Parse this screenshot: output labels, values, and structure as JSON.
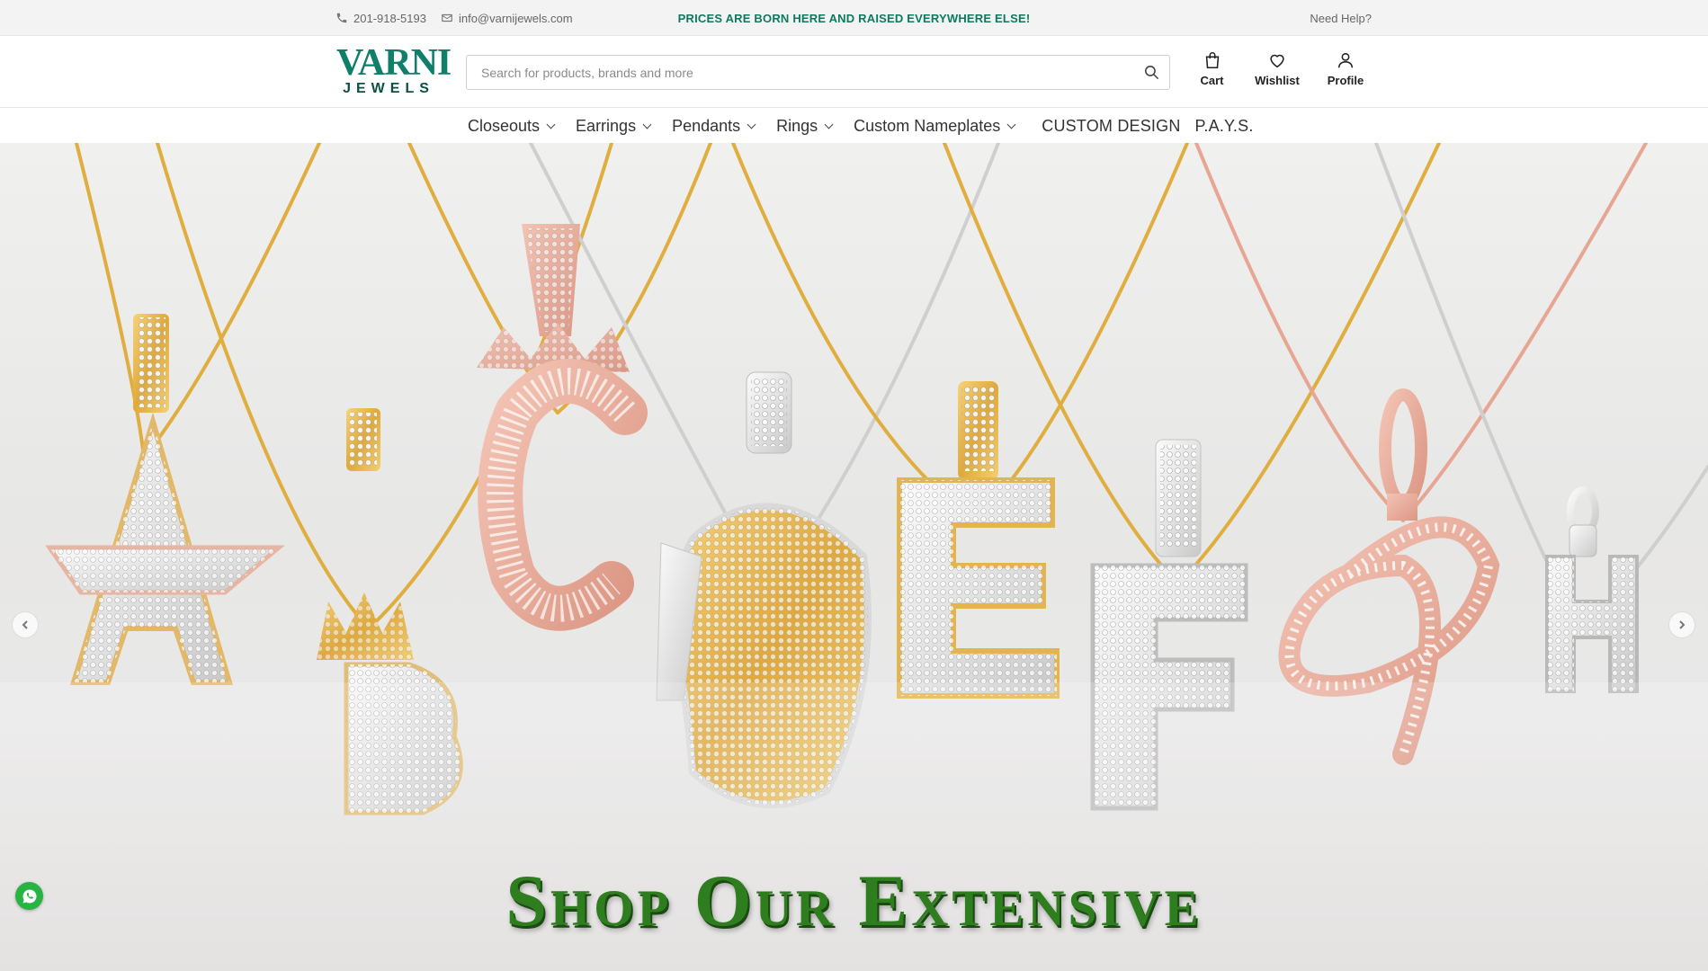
{
  "topbar": {
    "phone": "201-918-5193",
    "email": "info@varnijewels.com",
    "promo": "PRICES ARE BORN HERE AND RAISED EVERYWHERE ELSE!",
    "help": "Need Help?"
  },
  "header": {
    "logo_main": "VARNI",
    "logo_sub": "JEWELS",
    "search_placeholder": "Search for products, brands and more",
    "search_value": "",
    "cart_label": "Cart",
    "wishlist_label": "Wishlist",
    "profile_label": "Profile"
  },
  "nav": {
    "items": [
      {
        "label": "Closeouts",
        "dropdown": true
      },
      {
        "label": "Earrings",
        "dropdown": true
      },
      {
        "label": "Pendants",
        "dropdown": true
      },
      {
        "label": "Rings",
        "dropdown": true
      },
      {
        "label": "Custom Nameplates",
        "dropdown": true
      },
      {
        "label": "CUSTOM DESIGN",
        "dropdown": false
      },
      {
        "label": "P.A.Y.S.",
        "dropdown": false
      }
    ]
  },
  "hero": {
    "headline": "Shop Our Extensive",
    "letters": [
      "A",
      "B",
      "C",
      "D",
      "E",
      "F",
      "G",
      "H"
    ]
  },
  "colors": {
    "brand_green": "#0f7f6a",
    "promo_green": "#0d7a5f",
    "headline_green": "#2e7d1f",
    "gold": "#e5b23c",
    "rose": "#e7a593",
    "silver": "#d8d8d8",
    "whatsapp": "#27b443"
  },
  "icons": {
    "phone": "phone-icon",
    "email": "envelope-icon",
    "search": "search-icon",
    "cart": "shopping-bag-icon",
    "wishlist": "heart-icon",
    "profile": "user-icon",
    "prev": "chevron-left-icon",
    "next": "chevron-right-icon",
    "whatsapp": "whatsapp-icon"
  }
}
